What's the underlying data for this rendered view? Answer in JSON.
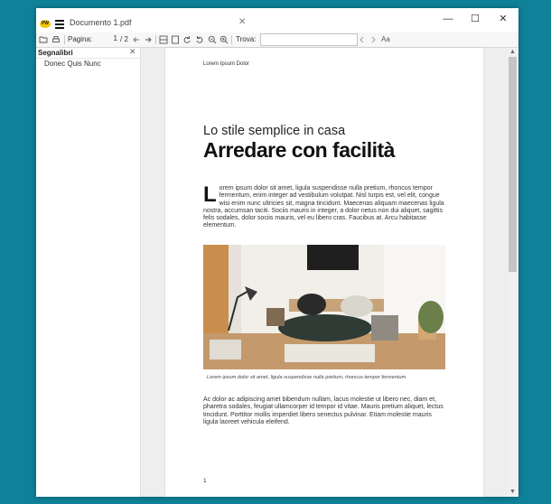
{
  "window": {
    "tab_title": "Documento 1.pdf",
    "app_logo_text": "PW",
    "controls": {
      "minimize": "—",
      "maximize": "☐",
      "close": "✕"
    }
  },
  "toolbar": {
    "page_label": "Pagina:",
    "current_page": "1",
    "page_total": "/ 2",
    "find_label": "Trova:",
    "find_placeholder": "",
    "case_toggle": "Aa"
  },
  "sidebar": {
    "title": "Segnalibri",
    "items": [
      {
        "label": "Donec Quis Nunc"
      }
    ]
  },
  "document": {
    "header": "Lorem Ipsum Dolor",
    "subtitle": "Lo stile semplice in casa",
    "title": "Arredare con facilità",
    "dropcap": "L",
    "para1": "orem ipsum dolor sit amet, ligula suspendisse nulla pretium, rhoncus tempor fermentum, enim integer ad vestibulum volutpat. Nisl turpis est, vel elit, congue wisi enim nunc ultricies sit, magna tincidunt. Maecenas aliquam maecenas ligula nostra, accumsan taciti. Sociis mauris in integer, a dolor netus non dui aliquet, sagittis felis sodales, dolor sociis mauris, vel eu libero cras. Faucibus at. Arcu habitasse elementum.",
    "caption": "Lorem ipsum dolor sit amet, ligula suspendisse nulla pretium, rhoncus tempor fermentum.",
    "para2": "Ac dolor ac adipiscing amet bibendum nullam, lacus molestie ut libero nec, diam et, pharetra sodales, feugiat ullamcorper id tempor id vitae. Mauris pretium aliquet, lectus tincidunt. Porttitor mollis imperdiet libero senectus pulvinar. Etiam molestie mauris ligula laoreet vehicula eleifend.",
    "page_number": "1"
  },
  "scrollbar": {
    "up": "▲",
    "down": "▼"
  }
}
